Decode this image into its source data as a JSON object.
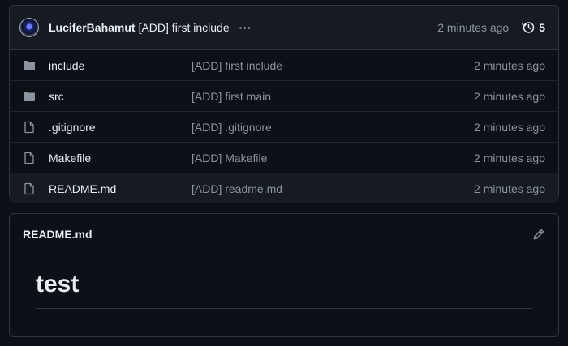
{
  "commit": {
    "author": "LuciferBahamut",
    "message": "[ADD] first include",
    "more": "···",
    "time": "2 minutes ago",
    "history_count": "5"
  },
  "files": [
    {
      "type": "folder",
      "icon": "folder-icon",
      "name": "include",
      "message": "[ADD] first include",
      "time": "2 minutes ago"
    },
    {
      "type": "folder",
      "icon": "folder-icon",
      "name": "src",
      "message": "[ADD] first main",
      "time": "2 minutes ago"
    },
    {
      "type": "file",
      "icon": "file-icon",
      "name": ".gitignore",
      "message": "[ADD] .gitignore",
      "time": "2 minutes ago"
    },
    {
      "type": "file",
      "icon": "file-icon",
      "name": "Makefile",
      "message": "[ADD] Makefile",
      "time": "2 minutes ago"
    },
    {
      "type": "file",
      "icon": "file-icon",
      "name": "README.md",
      "message": "[ADD] readme.md",
      "time": "2 minutes ago"
    }
  ],
  "readme": {
    "title": "README.md",
    "heading": "test"
  },
  "colors": {
    "background": "#0d1117",
    "panel": "#161b22",
    "border": "#30363d",
    "muted": "#8b949e",
    "text": "#e6edf3"
  }
}
